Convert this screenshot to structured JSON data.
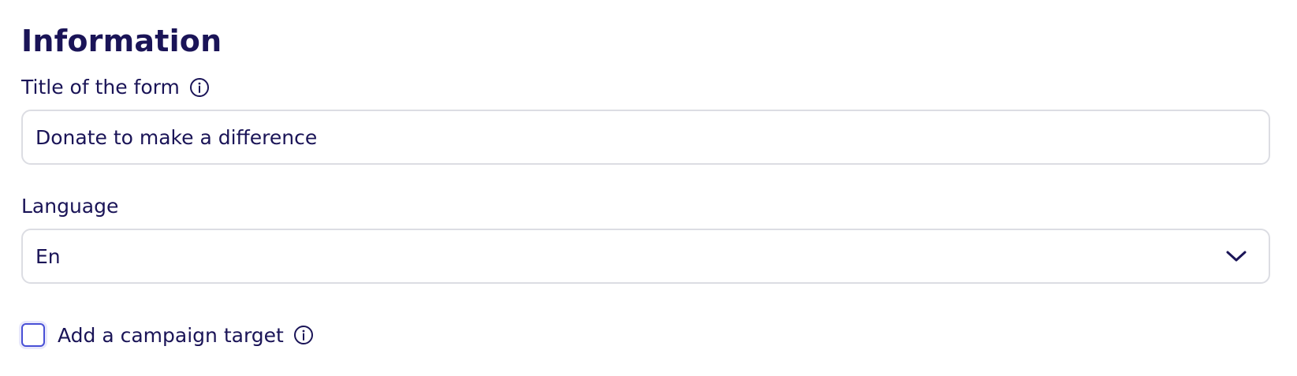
{
  "section": {
    "title": "Information"
  },
  "form_title": {
    "label": "Title of the form",
    "value": "Donate to make a difference",
    "info_icon": "info-icon"
  },
  "language": {
    "label": "Language",
    "selected": "En",
    "dropdown_icon": "chevron-down-icon"
  },
  "campaign_target": {
    "label": "Add a campaign target",
    "checked": false,
    "info_icon": "info-icon"
  },
  "colors": {
    "text": "#1a1457",
    "border": "#dcdde3",
    "checkbox_border": "#4950d6"
  }
}
